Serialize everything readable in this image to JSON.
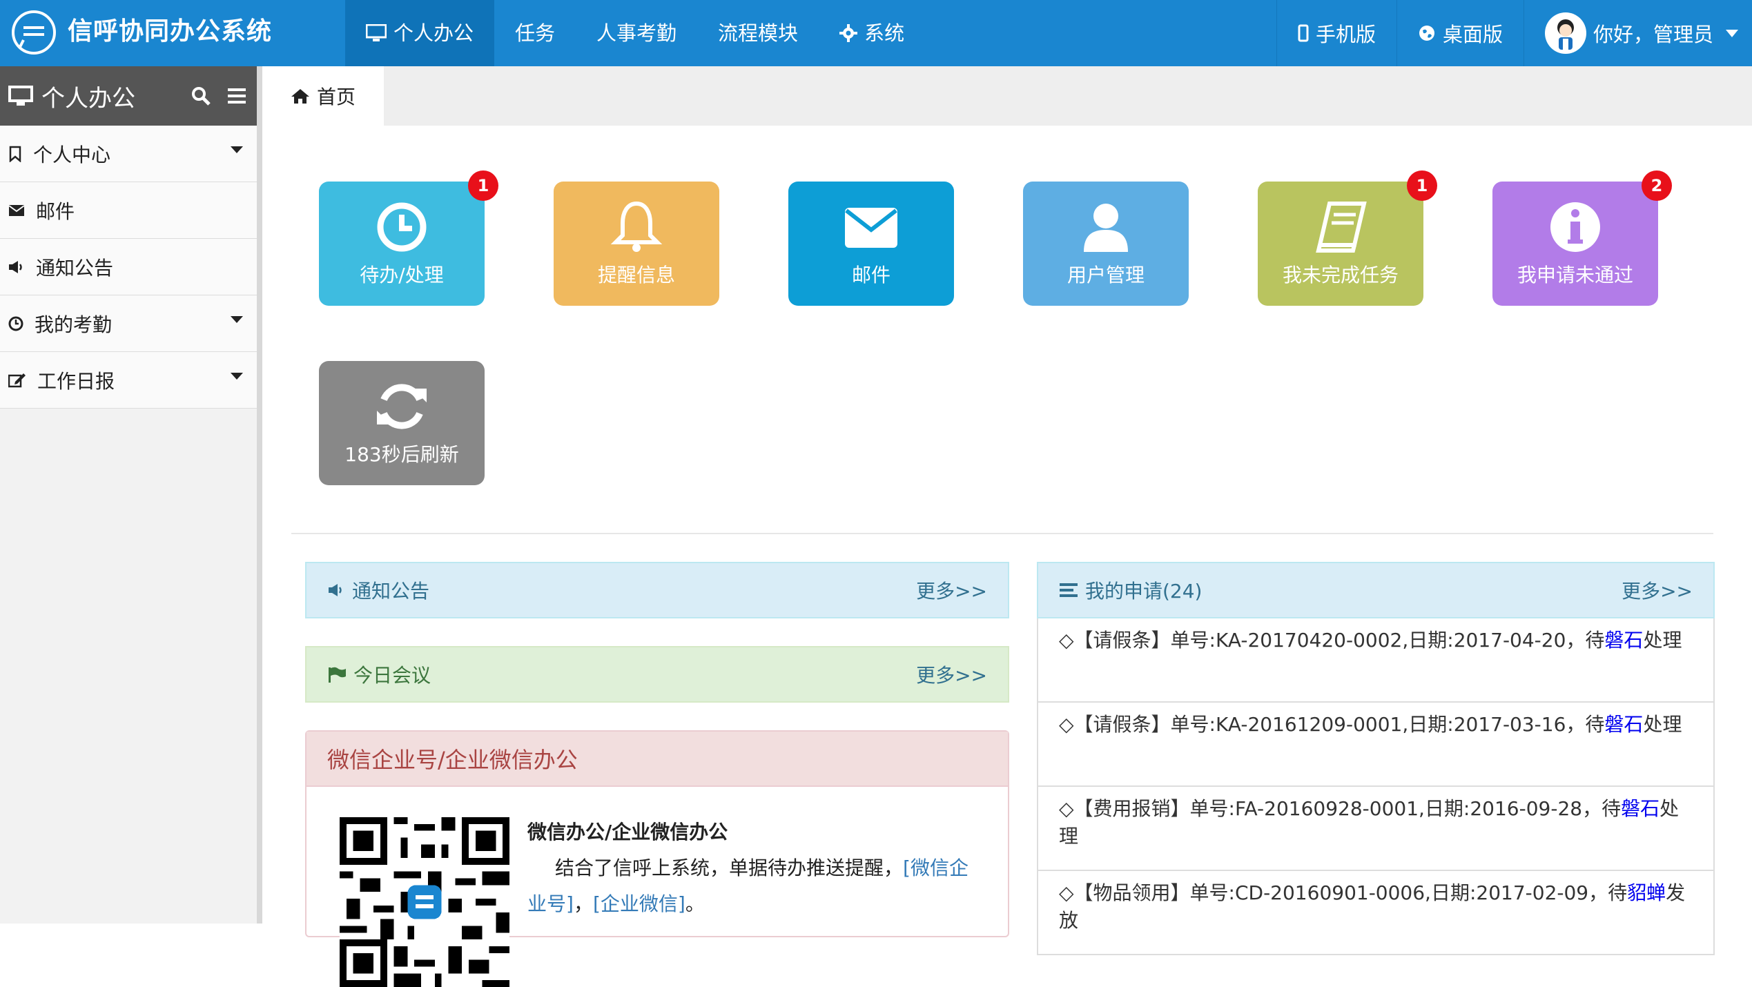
{
  "topbar": {
    "title": "信呼协同办公系统",
    "nav": [
      {
        "label": "个人办公",
        "icon": "monitor-icon"
      },
      {
        "label": "任务"
      },
      {
        "label": "人事考勤"
      },
      {
        "label": "流程模块"
      },
      {
        "label": "系统",
        "icon": "gear-icon"
      }
    ],
    "mobile_label": "手机版",
    "desktop_label": "桌面版",
    "user_greeting": "你好，管理员"
  },
  "sidebar": {
    "title": "个人办公",
    "items": [
      {
        "label": "个人中心",
        "icon": "bookmark-icon",
        "expandable": true
      },
      {
        "label": "邮件",
        "icon": "envelope-icon",
        "expandable": false
      },
      {
        "label": "通知公告",
        "icon": "bullhorn-icon",
        "expandable": false
      },
      {
        "label": "我的考勤",
        "icon": "clock-icon",
        "expandable": true
      },
      {
        "label": "工作日报",
        "icon": "edit-icon",
        "expandable": true
      }
    ]
  },
  "tabs": {
    "home_label": "首页"
  },
  "tiles": [
    {
      "label": "待办/处理",
      "icon": "clock-icon",
      "color": "#3ebce0",
      "badge": "1"
    },
    {
      "label": "提醒信息",
      "icon": "bell-icon",
      "color": "#f0b95e",
      "badge": ""
    },
    {
      "label": "邮件",
      "icon": "envelope-icon",
      "color": "#0d9ed6",
      "badge": ""
    },
    {
      "label": "用户管理",
      "icon": "user-icon",
      "color": "#5eaee3",
      "badge": ""
    },
    {
      "label": "我未完成任务",
      "icon": "book-icon",
      "color": "#b9c45f",
      "badge": "1"
    },
    {
      "label": "我申请未通过",
      "icon": "info-icon",
      "color": "#b27ce8",
      "badge": "2"
    },
    {
      "label": "183秒后刷新",
      "icon": "refresh-icon",
      "color": "#888888",
      "badge": ""
    }
  ],
  "panels": {
    "notice": {
      "title": "通知公告",
      "more": "更多>>",
      "color": "#31708f",
      "bg": "#d9edf7"
    },
    "meeting": {
      "title": "今日会议",
      "more": "更多>>",
      "color": "#3c763d",
      "bg": "#dff0d8"
    },
    "requests": {
      "title": "我的申请(24)",
      "more": "更多>>",
      "color": "#31708f",
      "bg": "#d9edf7"
    }
  },
  "wechat": {
    "head": "微信企业号/企业微信办公",
    "title": "微信办公/企业微信办公",
    "text_prefix": "结合了信呼上系统，单据待办推送提醒，",
    "link1": "[微信企业号]",
    "sep": "，",
    "link2": "[企业微信]",
    "end": "。"
  },
  "requests": [
    {
      "text": "◇【请假条】单号:KA-20170420-0002,日期:2017-04-20，待",
      "who": "磐石",
      "tail": "处理"
    },
    {
      "text": "◇【请假条】单号:KA-20161209-0001,日期:2017-03-16，待",
      "who": "磐石",
      "tail": "处理"
    },
    {
      "text": "◇【费用报销】单号:FA-20160928-0001,日期:2016-09-28，待",
      "who": "磐石",
      "tail": "处理"
    },
    {
      "text": "◇【物品领用】单号:CD-20160901-0006,日期:2017-02-09，待",
      "who": "貂蝉",
      "tail": "发放"
    }
  ]
}
